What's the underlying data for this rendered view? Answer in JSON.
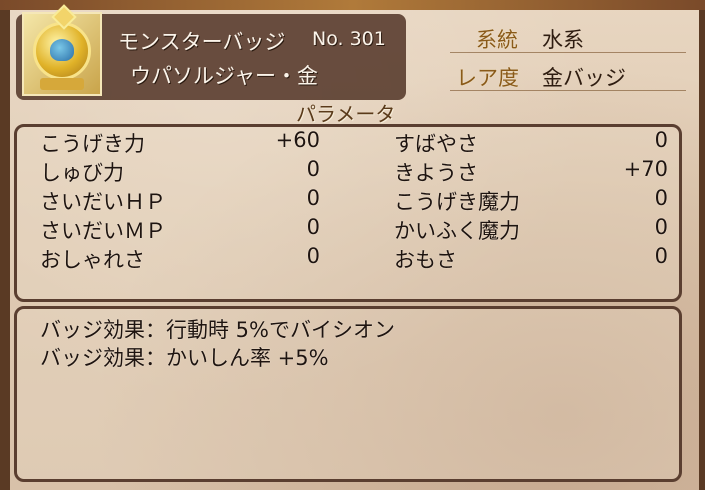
{
  "badge": {
    "category": "モンスターバッジ",
    "number": "No. 301",
    "name": "ウパソルジャー・金"
  },
  "info": {
    "type_label": "系統",
    "type_value": "水系",
    "rarity_label": "レア度",
    "rarity_value": "金バッジ"
  },
  "params": {
    "title": "パラメータ",
    "left": [
      {
        "name": "こうげき力",
        "value": "+60"
      },
      {
        "name": "しゅび力",
        "value": "0"
      },
      {
        "name": "さいだいＨＰ",
        "value": "0"
      },
      {
        "name": "さいだいＭＰ",
        "value": "0"
      },
      {
        "name": "おしゃれさ",
        "value": "0"
      }
    ],
    "right": [
      {
        "name": "すばやさ",
        "value": "0"
      },
      {
        "name": "きようさ",
        "value": "+70"
      },
      {
        "name": "こうげき魔力",
        "value": "0"
      },
      {
        "name": "かいふく魔力",
        "value": "0"
      },
      {
        "name": "おもさ",
        "value": "0"
      }
    ]
  },
  "effects": [
    "バッジ効果：行動時 5%でバイシオン",
    "バッジ効果：かいしん率 +5%"
  ]
}
